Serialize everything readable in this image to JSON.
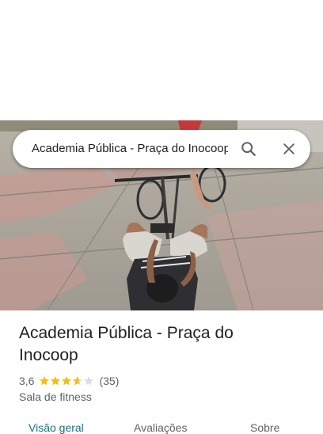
{
  "search": {
    "query": "Academia Pública - Praça do Inocoop"
  },
  "place": {
    "title": "Academia Pública - Praça do Inocoop",
    "rating": "3,6",
    "stars": 3.6,
    "review_count": "(35)",
    "category": "Sala de fitness"
  },
  "tabs": [
    {
      "label": "Visão geral",
      "active": true
    },
    {
      "label": "Avaliações",
      "active": false
    },
    {
      "label": "Sobre",
      "active": false
    }
  ],
  "icons": {
    "search": "search-icon",
    "close": "close-icon",
    "star": "star-icon"
  },
  "colors": {
    "star_filled": "#fbbc04",
    "star_empty": "#dadce0",
    "active_tab": "#0b7a80"
  }
}
